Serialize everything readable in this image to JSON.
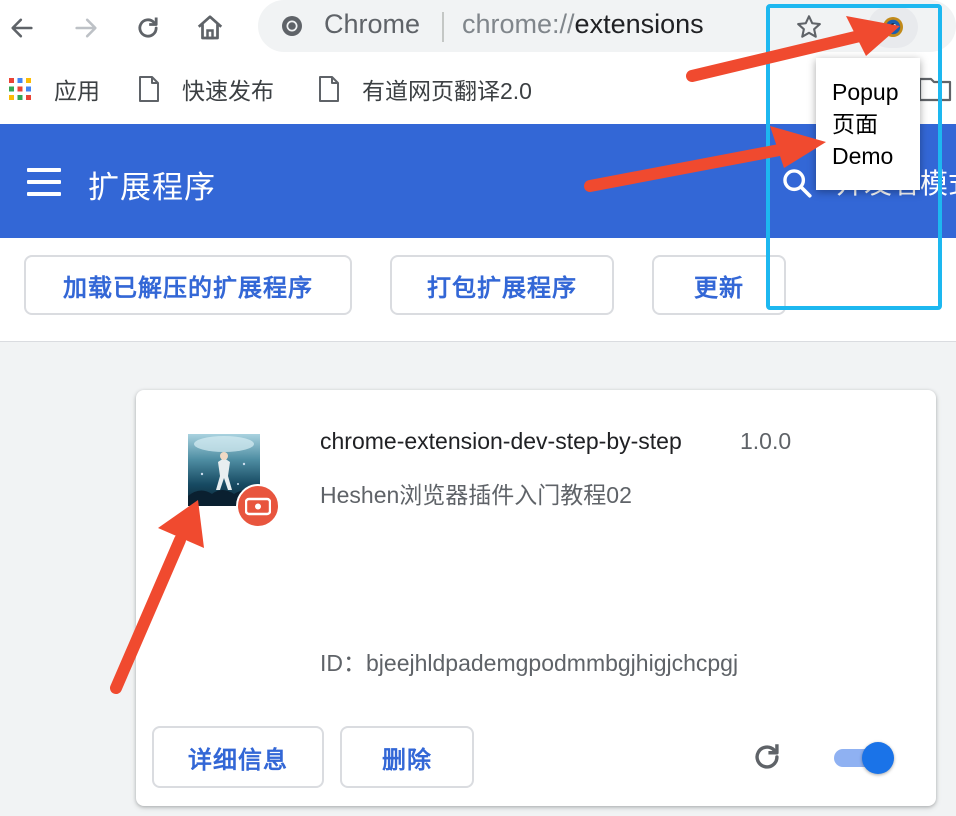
{
  "browser": {
    "site_label": "Chrome",
    "url_scheme": "chrome://",
    "url_host": "extensions",
    "icons": {
      "back": "arrow-left-icon",
      "forward": "arrow-right-icon",
      "reload": "reload-icon",
      "home": "home-icon",
      "bookmark_star": "star-icon",
      "extension": "extension-action-icon"
    }
  },
  "bookmarks_bar": {
    "items": [
      {
        "label": "应用",
        "icon": "apps-grid-icon"
      },
      {
        "label": "快速发布",
        "icon": "page-icon"
      },
      {
        "label": "有道网页翻译2.0",
        "icon": "page-icon"
      }
    ]
  },
  "header": {
    "title": "扩展程序",
    "search_partial": "开发者模式"
  },
  "actions": {
    "load_unpacked": "加载已解压的扩展程序",
    "pack": "打包扩展程序",
    "update": "更新"
  },
  "extension": {
    "name": "chrome-extension-dev-step-by-step",
    "version": "1.0.0",
    "description": "Heshen浏览器插件入门教程02",
    "id_text": "ID：bjeejhldpademgpodmmbgjhigjchcpgj",
    "details_label": "详细信息",
    "remove_label": "删除",
    "enabled": true
  },
  "popup": {
    "lines": [
      "Popup",
      "页面",
      "Demo"
    ]
  },
  "colors": {
    "header_blue": "#3367d6",
    "button_text": "#3367d6",
    "toggle_on": "#1a73e8",
    "annotation_arrow": "#f04a2f",
    "highlight_box": "#1db8f0"
  }
}
